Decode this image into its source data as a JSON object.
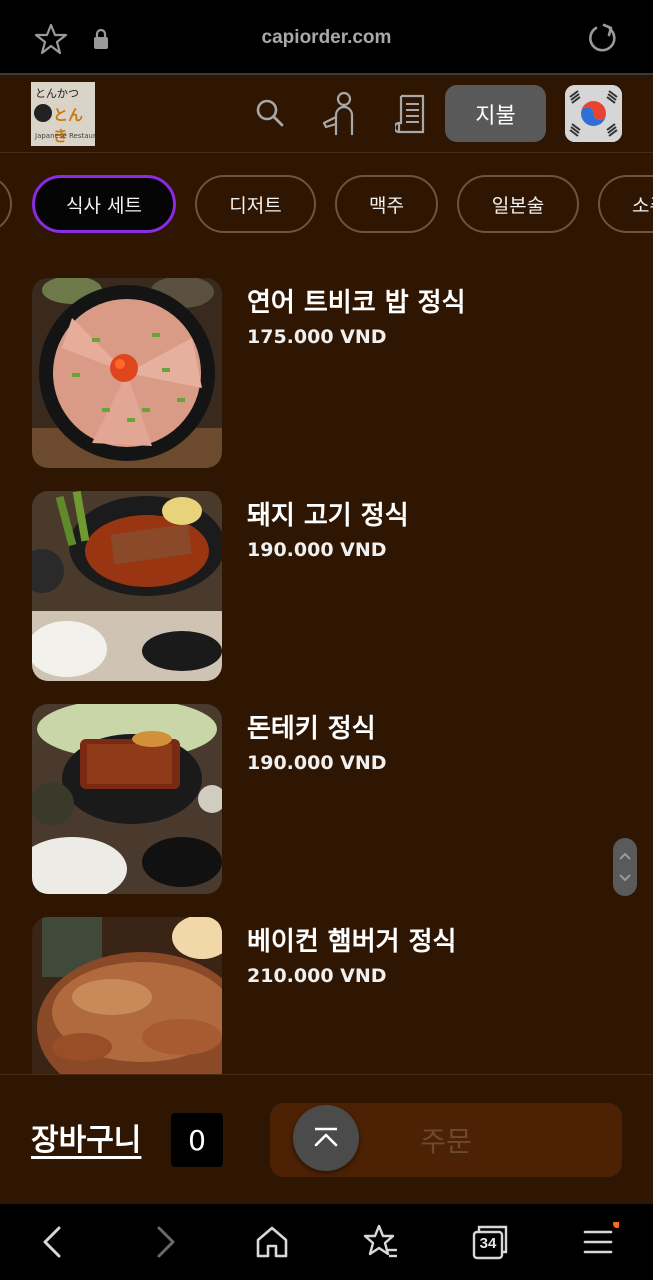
{
  "browser": {
    "url": "capiorder.com",
    "tab_count": "34"
  },
  "header": {
    "logo_text_top": "とんかつ",
    "logo_text_main": "とんき",
    "logo_text_bottom": "Japanese Restaurant",
    "pay_label": "지불"
  },
  "categories": [
    {
      "label": ""
    },
    {
      "label": "식사 세트",
      "active": true
    },
    {
      "label": "디저트"
    },
    {
      "label": "맥주"
    },
    {
      "label": "일본술"
    },
    {
      "label": "소주"
    }
  ],
  "menu_items": [
    {
      "name": "연어 트비코 밥 정식",
      "price": "175.000 VND",
      "image": "salmon-tobiko-rice-bowl"
    },
    {
      "name": "돼지 고기 정식",
      "price": "190.000 VND",
      "image": "pork-set"
    },
    {
      "name": "돈테키 정식",
      "price": "190.000 VND",
      "image": "tonteki-set"
    },
    {
      "name": "베이컨 햄버거 정식",
      "price": "210.000 VND",
      "image": "bacon-hamburg-steak"
    }
  ],
  "cart": {
    "label": "장바구니",
    "count": "0",
    "order_label": "주문"
  },
  "colors": {
    "background": "#2e1602",
    "active_chip_border": "#8a2be2",
    "order_button": "#4d2204",
    "pay_button": "#595959"
  },
  "icons": [
    "star-icon",
    "lock-icon",
    "reload-icon",
    "search-icon",
    "call-staff-icon",
    "bill-icon",
    "korea-flag-icon",
    "back-icon",
    "forward-icon",
    "home-icon",
    "bookmarks-icon",
    "tabs-icon",
    "menu-icon",
    "scroll-top-icon"
  ]
}
